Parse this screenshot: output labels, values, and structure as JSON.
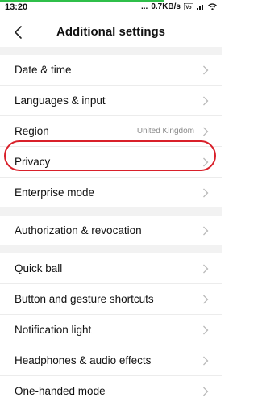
{
  "status": {
    "time": "13:20",
    "dots": "...",
    "speed": "0.7KB/s",
    "progress_percent": 74,
    "accent": "#2fbf4a"
  },
  "header": {
    "title": "Additional settings",
    "back_icon": "chevron-left-icon"
  },
  "groups": [
    {
      "items": [
        {
          "label": "Date & time",
          "value": ""
        },
        {
          "label": "Languages & input",
          "value": ""
        },
        {
          "label": "Region",
          "value": "United Kingdom"
        },
        {
          "label": "Privacy",
          "value": "",
          "highlighted": true
        },
        {
          "label": "Enterprise mode",
          "value": ""
        }
      ]
    },
    {
      "items": [
        {
          "label": "Authorization & revocation",
          "value": ""
        }
      ]
    },
    {
      "items": [
        {
          "label": "Quick ball",
          "value": ""
        },
        {
          "label": "Button and gesture shortcuts",
          "value": ""
        },
        {
          "label": "Notification light",
          "value": ""
        },
        {
          "label": "Headphones & audio effects",
          "value": ""
        },
        {
          "label": "One-handed mode",
          "value": ""
        }
      ]
    }
  ],
  "highlight_color": "#d9202a"
}
